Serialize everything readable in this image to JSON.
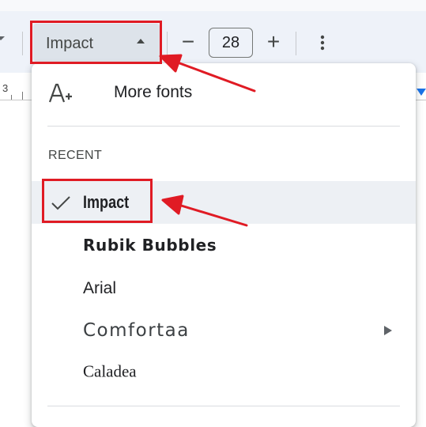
{
  "toolbar": {
    "font_picker": {
      "label": "Impact",
      "icon": "caret-up-icon"
    },
    "font_size": {
      "decrease_label": "−",
      "value": "28",
      "increase_label": "+"
    },
    "more_options_icon": "more-vertical-icon"
  },
  "ruler": {
    "number": "3",
    "marker_color": "#1a73e8"
  },
  "font_menu": {
    "more_fonts": {
      "label": "More fonts",
      "icon": "font-add-icon"
    },
    "section_label": "RECENT",
    "items": [
      {
        "label": "Impact",
        "selected": true,
        "icon": "check-icon"
      },
      {
        "label": "Rubik Bubbles",
        "selected": false
      },
      {
        "label": "Arial",
        "selected": false
      },
      {
        "label": "Comfortaa",
        "selected": false,
        "has_submenu": true,
        "icon": "submenu-arrow-icon"
      },
      {
        "label": "Caladea",
        "selected": false
      }
    ]
  },
  "annotations": {
    "color": "#e01b24"
  }
}
